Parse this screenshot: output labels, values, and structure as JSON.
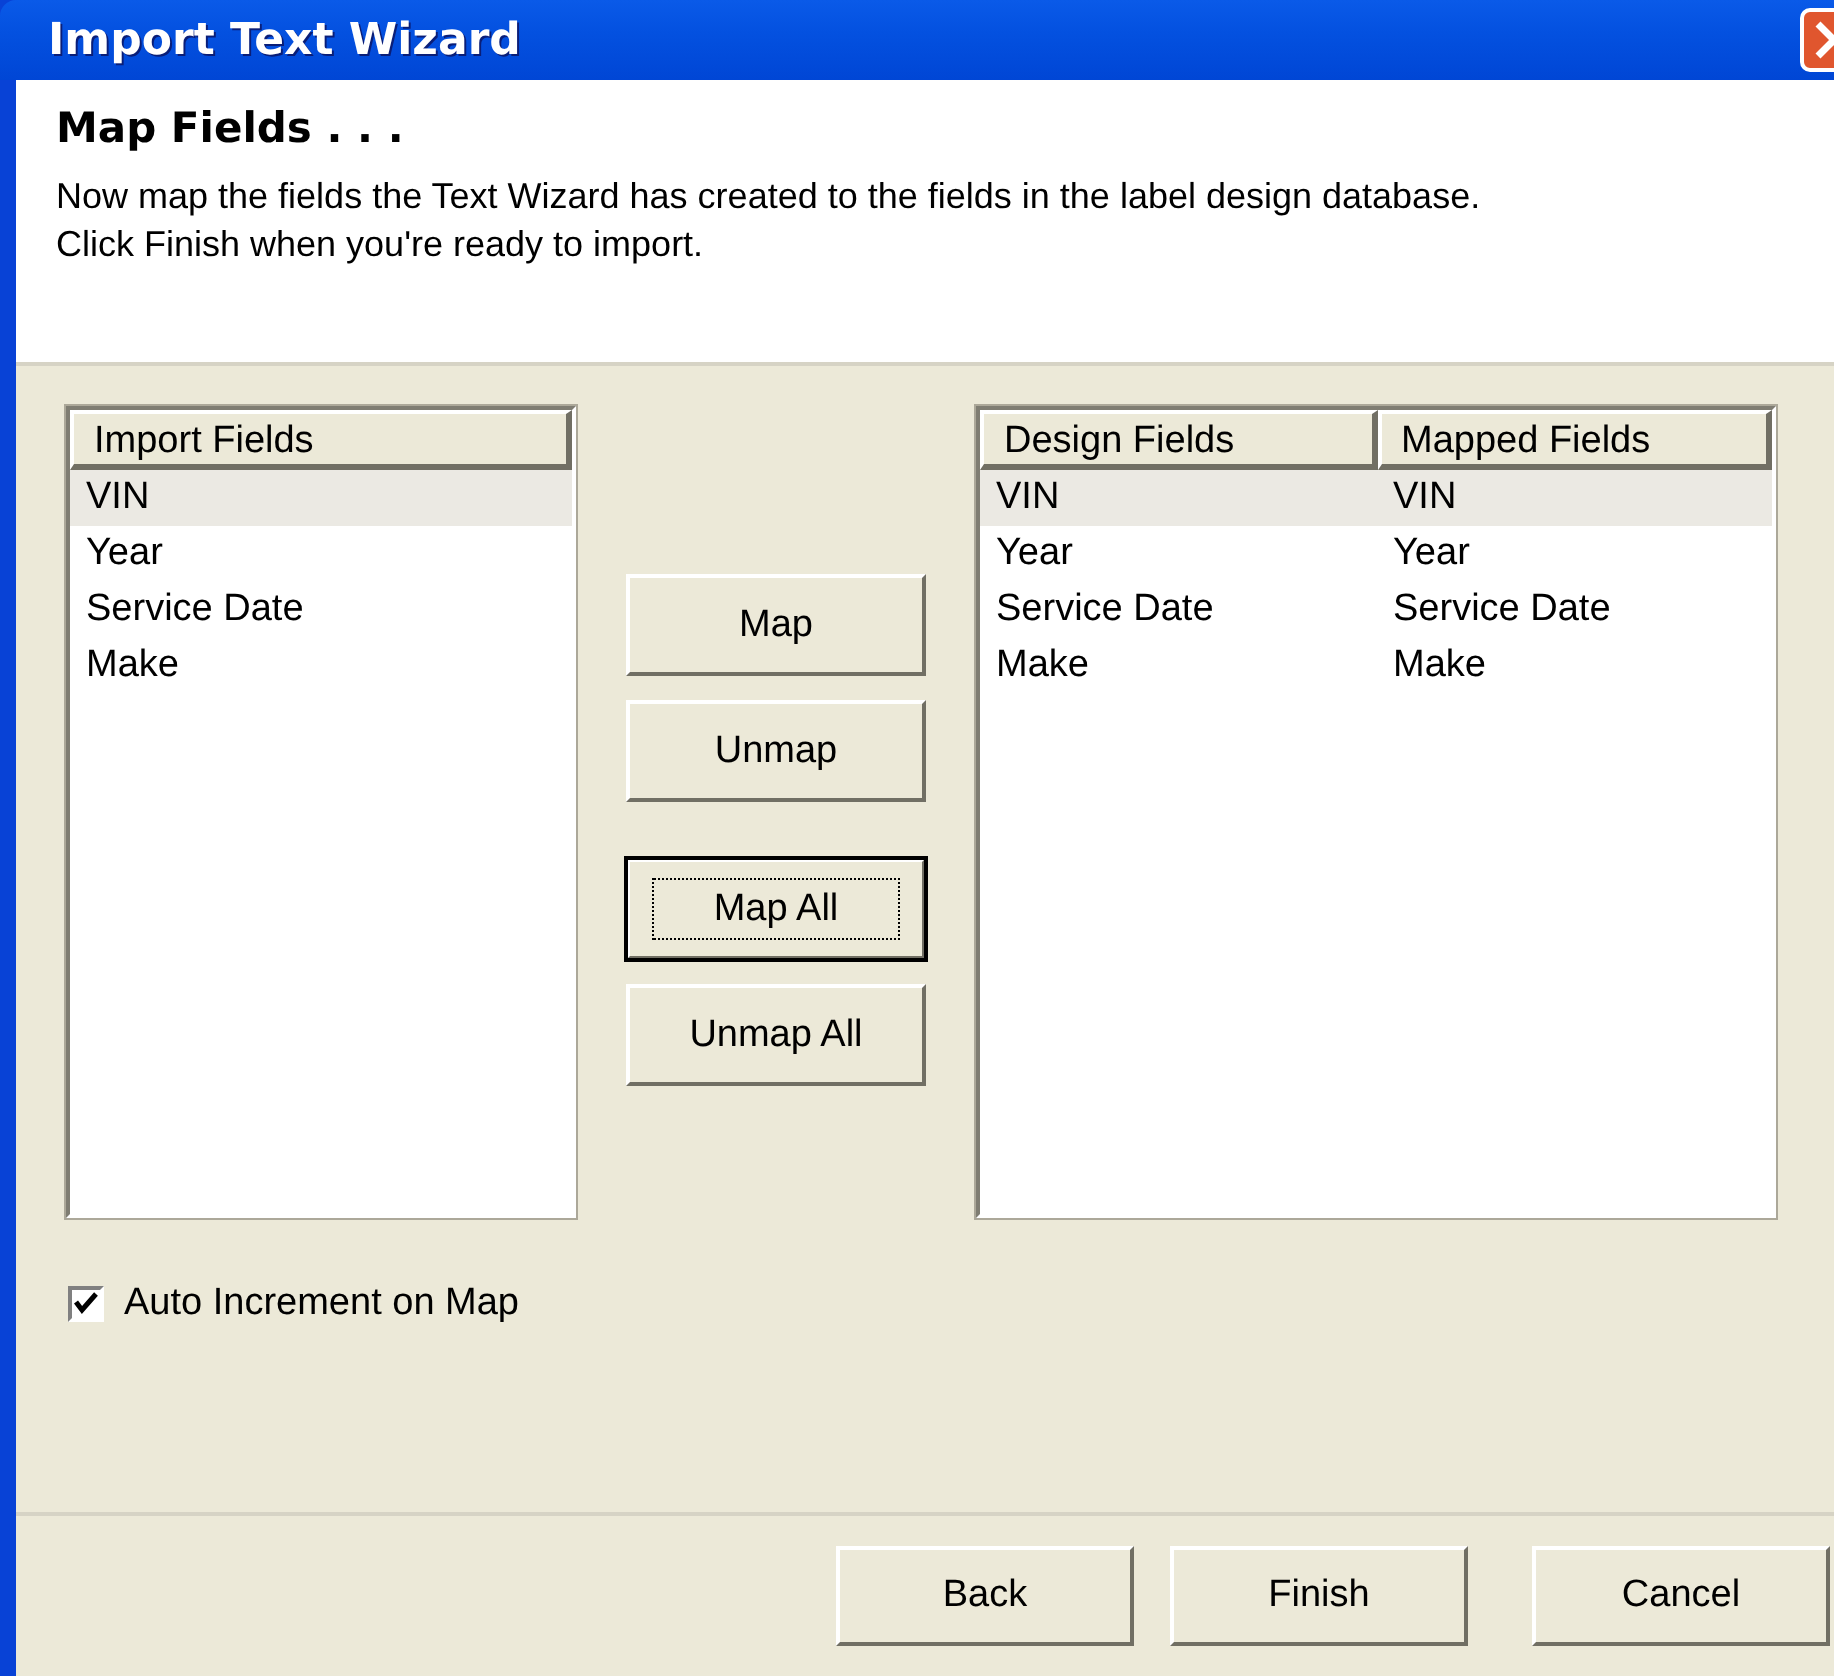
{
  "window": {
    "title": "Import Text Wizard"
  },
  "header": {
    "title": "Map Fields . . .",
    "description": "Now map the fields the Text Wizard has created to the fields in the label design database.\nClick Finish when you're ready to import."
  },
  "import_list": {
    "columns": [
      "Import Fields"
    ],
    "rows": [
      {
        "cells": [
          "VIN"
        ],
        "selected": true
      },
      {
        "cells": [
          "Year"
        ],
        "selected": false
      },
      {
        "cells": [
          "Service Date"
        ],
        "selected": false
      },
      {
        "cells": [
          "Make"
        ],
        "selected": false
      }
    ]
  },
  "middle_buttons": [
    {
      "label": "Map",
      "default": false
    },
    {
      "label": "Unmap",
      "default": false
    },
    {
      "label": "Map All",
      "default": true
    },
    {
      "label": "Unmap All",
      "default": false
    }
  ],
  "design_list": {
    "columns": [
      "Design Fields",
      "Mapped Fields"
    ],
    "rows": [
      {
        "cells": [
          "VIN",
          "VIN"
        ],
        "selected": true
      },
      {
        "cells": [
          "Year",
          "Year"
        ],
        "selected": false
      },
      {
        "cells": [
          "Service Date",
          "Service Date"
        ],
        "selected": false
      },
      {
        "cells": [
          "Make",
          "Make"
        ],
        "selected": false
      }
    ]
  },
  "auto_increment": {
    "label": "Auto Increment on Map",
    "checked": true
  },
  "footer_buttons": [
    "Back",
    "Finish",
    "Cancel"
  ]
}
